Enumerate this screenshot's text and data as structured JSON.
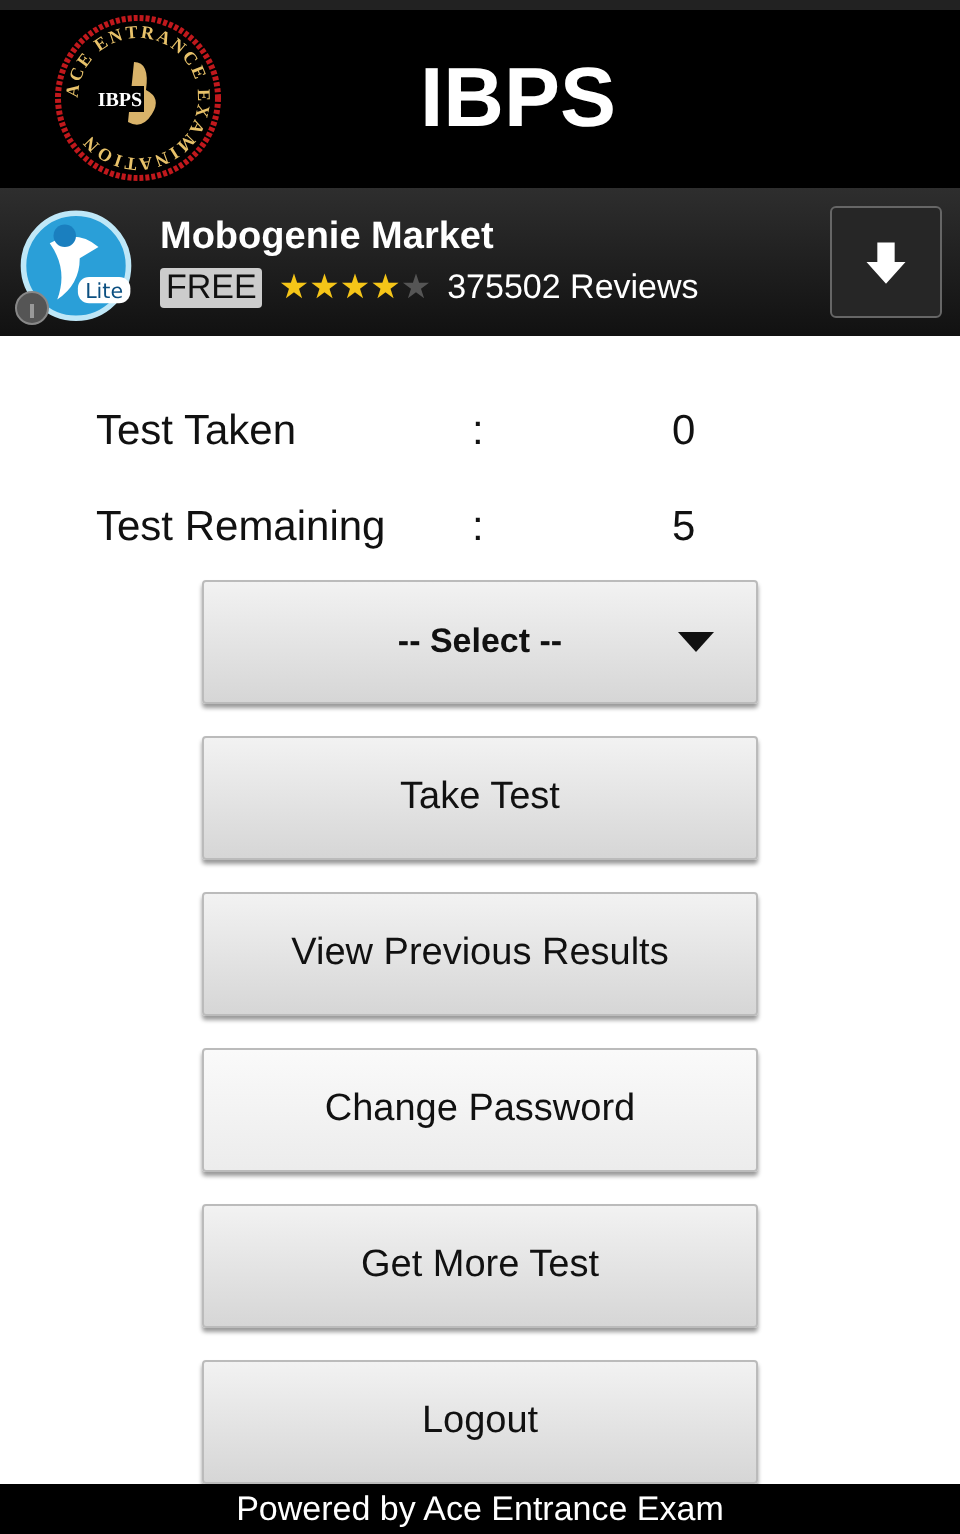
{
  "header": {
    "title": "IBPS",
    "logo": {
      "ring_text": "ACE ENTRANCE EXAMINATION",
      "center_text": "IBPS"
    }
  },
  "ad": {
    "title": "Mobogenie Market",
    "badge": "FREE",
    "stars": 4,
    "reviews": "375502 Reviews",
    "icon_label": "Lite"
  },
  "stats": [
    {
      "label": "Test Taken",
      "separator": ":",
      "value": "0"
    },
    {
      "label": "Test Remaining",
      "separator": ":",
      "value": "5"
    }
  ],
  "select": {
    "value": "-- Select --"
  },
  "buttons": [
    {
      "label": "Take Test",
      "highlighted": false
    },
    {
      "label": "View Previous Results",
      "highlighted": false
    },
    {
      "label": "Change Password",
      "highlighted": true
    },
    {
      "label": "Get More Test",
      "highlighted": false
    },
    {
      "label": "Logout",
      "highlighted": false
    }
  ],
  "footer": "Powered by Ace Entrance Exam"
}
